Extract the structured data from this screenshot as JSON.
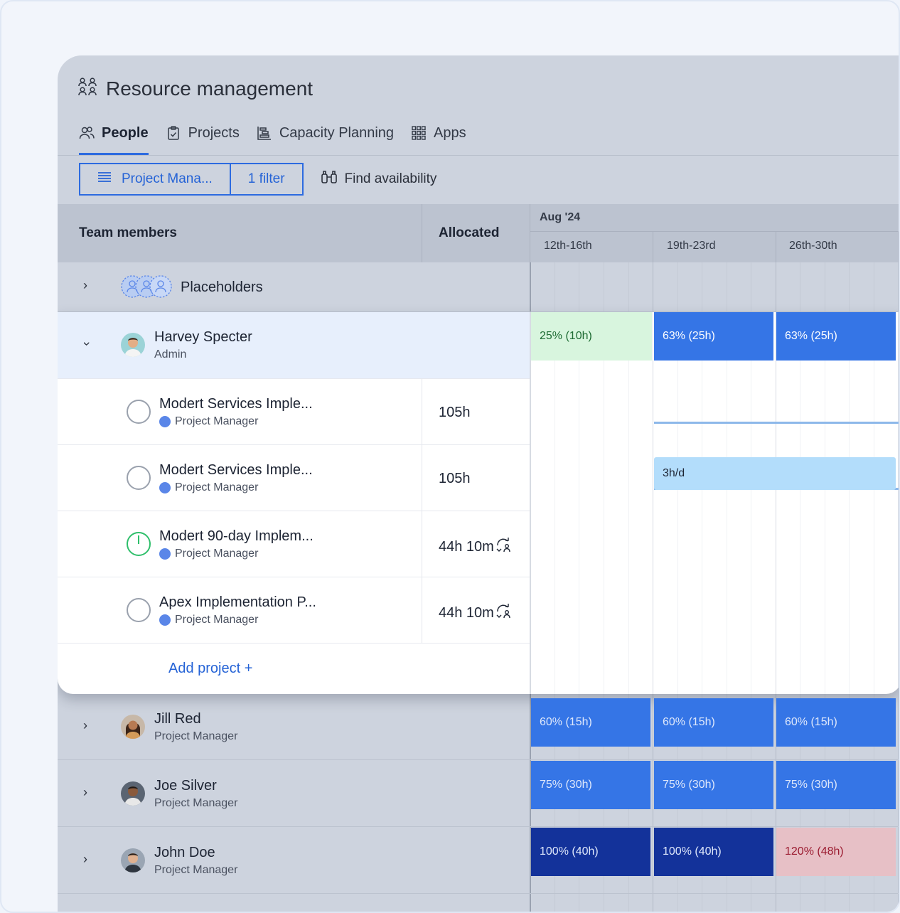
{
  "app": {
    "title": "Resource management"
  },
  "tabs": [
    {
      "label": "People",
      "active": true
    },
    {
      "label": "Projects"
    },
    {
      "label": "Capacity Planning"
    },
    {
      "label": "Apps"
    }
  ],
  "toolbar": {
    "view_label": "Project Mana...",
    "filter_label": "1 filter",
    "find_label": "Find availability"
  },
  "grid": {
    "col_team": "Team members",
    "col_alloc": "Allocated",
    "month": "Aug '24",
    "weeks": [
      "12th-16th",
      "19th-23rd",
      "26th-30th"
    ]
  },
  "placeholders": {
    "label": "Placeholders"
  },
  "harvey": {
    "name": "Harvey Specter",
    "role": "Admin",
    "bars": [
      "25% (10h)",
      "63% (25h)",
      "63% (25h)"
    ],
    "projects": [
      {
        "name": "Modert Services Imple...",
        "role": "Project Manager",
        "alloc": "105h"
      },
      {
        "name": "Modert Services Imple...",
        "role": "Project Manager",
        "alloc": "105h",
        "bar": "3h/d"
      },
      {
        "name": "Modert 90-day Implem...",
        "role": "Project Manager",
        "alloc": "44h 10m"
      },
      {
        "name": "Apex Implementation P...",
        "role": "Project Manager",
        "alloc": "44h 10m"
      }
    ],
    "add_project": "Add project +"
  },
  "people": [
    {
      "name": "Jill Red",
      "role": "Project Manager",
      "bars": [
        "60% (15h)",
        "60% (15h)",
        "60% (15h)"
      ]
    },
    {
      "name": "Joe Silver",
      "role": "Project Manager",
      "bars": [
        "75% (30h)",
        "75% (30h)",
        "75% (30h)"
      ]
    },
    {
      "name": "John Doe",
      "role": "Project Manager",
      "bars": [
        "100% (40h)",
        "100% (40h)",
        "120% (48h)"
      ]
    }
  ],
  "colors": {
    "accent": "#2d6be0",
    "under": "#d8f5de",
    "medium": "#3575e6",
    "full": "#13329a",
    "over": "#e7c0c6"
  }
}
